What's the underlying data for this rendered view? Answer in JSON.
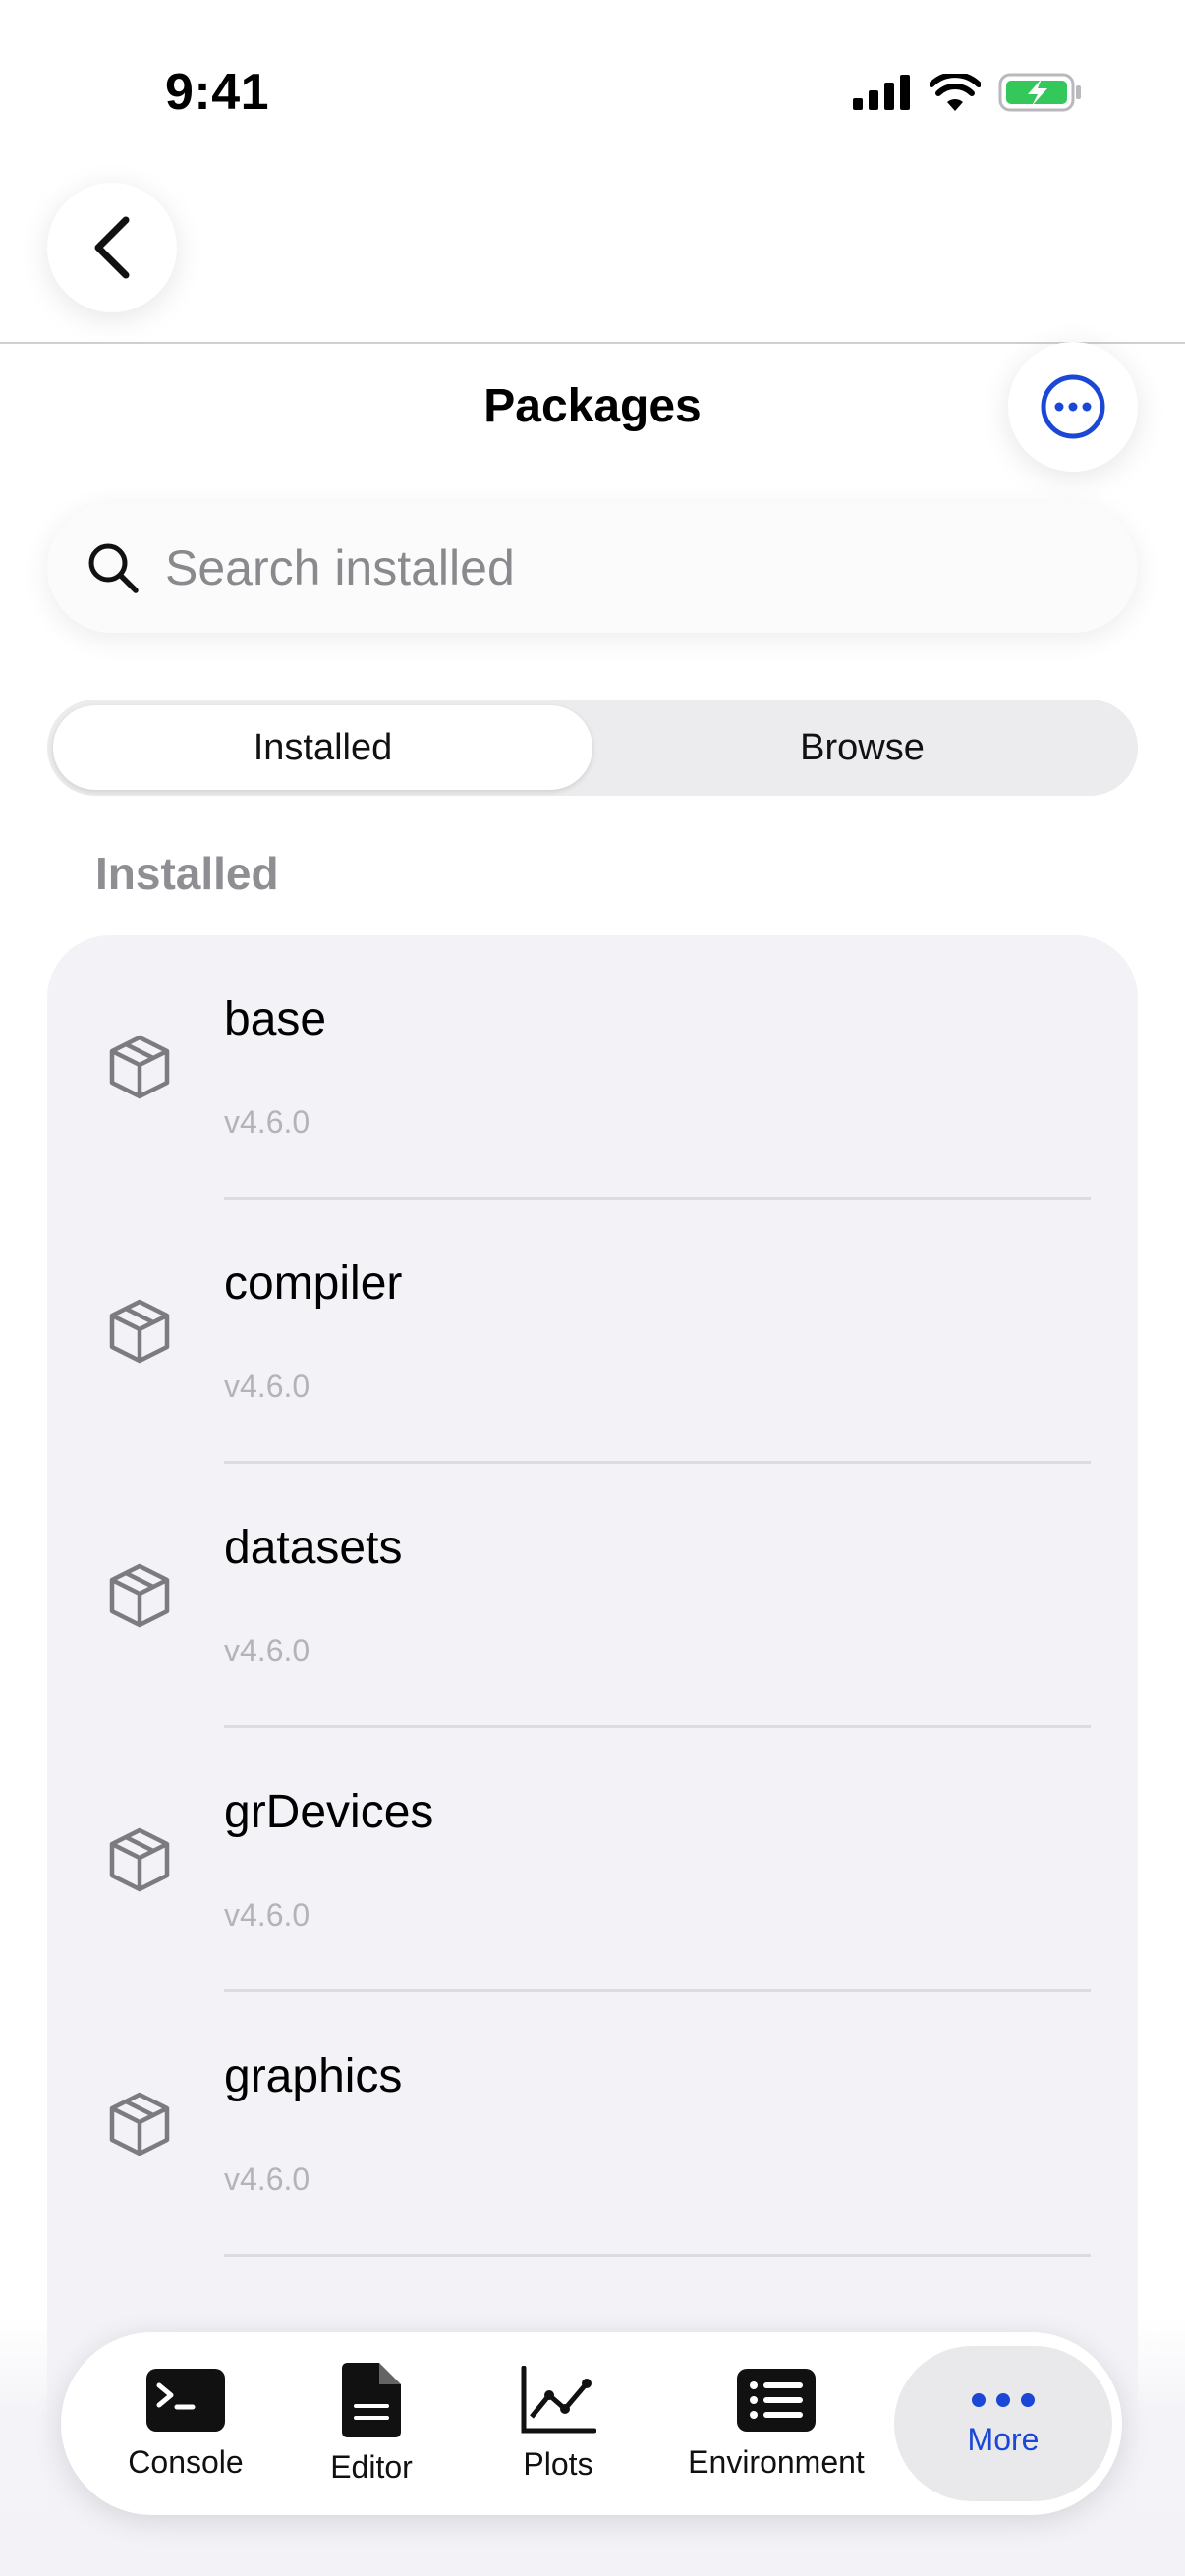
{
  "status": {
    "time": "9:41"
  },
  "header": {
    "title": "Packages"
  },
  "search": {
    "placeholder": "Search installed"
  },
  "segments": [
    {
      "label": "Installed",
      "active": true
    },
    {
      "label": "Browse",
      "active": false
    }
  ],
  "section": {
    "label": "Installed"
  },
  "packages": [
    {
      "name": "base",
      "version": "v4.6.0"
    },
    {
      "name": "compiler",
      "version": "v4.6.0"
    },
    {
      "name": "datasets",
      "version": "v4.6.0"
    },
    {
      "name": "grDevices",
      "version": "v4.6.0"
    },
    {
      "name": "graphics",
      "version": "v4.6.0"
    }
  ],
  "tabbar": {
    "items": [
      {
        "label": "Console",
        "icon": "terminal-icon"
      },
      {
        "label": "Editor",
        "icon": "document-icon"
      },
      {
        "label": "Plots",
        "icon": "chart-line-icon"
      },
      {
        "label": "Environment",
        "icon": "list-icon"
      },
      {
        "label": "More",
        "icon": "ellipsis-icon",
        "active": true
      }
    ]
  },
  "colors": {
    "accent": "#1a47d6",
    "battery": "#34c759"
  }
}
